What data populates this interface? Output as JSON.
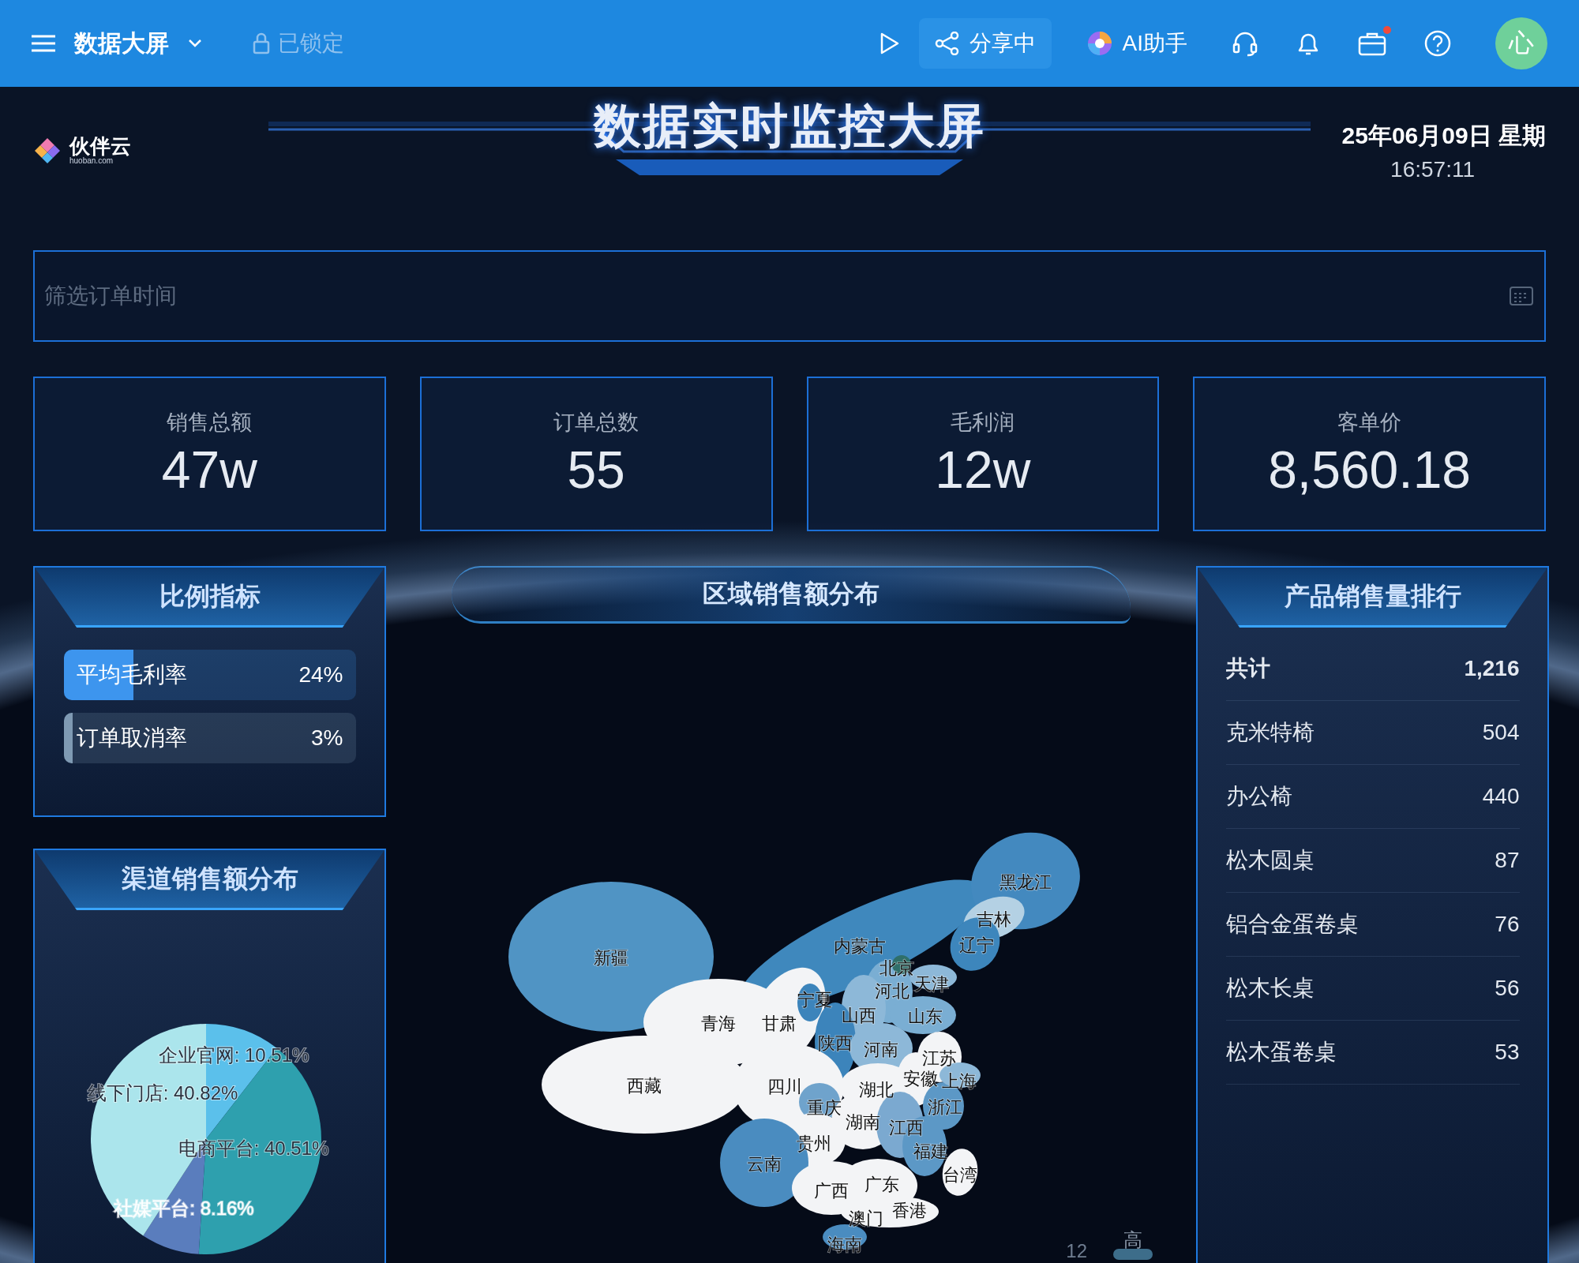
{
  "top_bar": {
    "title": "数据大屏",
    "lock_label": "已锁定",
    "locked": true,
    "share_button": "分享中",
    "ai_button": "AI助手",
    "notification_badge": true,
    "avatar_initial": "心"
  },
  "brand": {
    "name": "伙伴云",
    "domain": "huoban.com"
  },
  "header": {
    "title": "数据实时监控大屏",
    "date": "25年06月09日 星期",
    "time": "16:57:11"
  },
  "filter": {
    "placeholder": "筛选订单时间"
  },
  "kpis": [
    {
      "label": "销售总额",
      "value": "47w"
    },
    {
      "label": "订单总数",
      "value": "55"
    },
    {
      "label": "毛利润",
      "value": "12w"
    },
    {
      "label": "客单价",
      "value": "8,560.18"
    }
  ],
  "ratio_panel": {
    "title": "比例指标",
    "bars": [
      {
        "label": "平均毛利率",
        "level": 0.24,
        "reading": "24%",
        "color": "#3d95ee"
      },
      {
        "label": "订单取消率",
        "level": 0.03,
        "reading": "3%",
        "color": "#7f9ab3"
      }
    ]
  },
  "channel_panel": {
    "title": "渠道销售额分布",
    "chart_data": {
      "type": "pie",
      "values": [
        10.51,
        40.51,
        8.16,
        40.82
      ],
      "colors": [
        "#5bc0eb",
        "#2ea0ae",
        "#5a7dbd",
        "#abe5ec"
      ],
      "value_labels": [
        "企业官网: 10.51%",
        "电商平台: 40.51%",
        "社媒平台: 8.16%",
        "线下门店: 40.82%"
      ]
    }
  },
  "region_panel": {
    "title": "区域销售额分布",
    "provinces": [
      "黑龙江",
      "吉林",
      "内蒙古",
      "辽宁",
      "北京",
      "天津",
      "新疆",
      "河北",
      "宁夏",
      "山西",
      "山东",
      "青海",
      "甘肃",
      "陕西",
      "河南",
      "江苏",
      "西藏",
      "四川",
      "湖北",
      "安徽",
      "上海",
      "重庆",
      "浙江",
      "湖南",
      "江西",
      "贵州",
      "福建",
      "云南",
      "台湾",
      "广西",
      "广东",
      "香港",
      "澳门",
      "海南"
    ],
    "legend": {
      "high_label": "高",
      "value": "12"
    }
  },
  "product_panel": {
    "title": "产品销售量排行",
    "total": {
      "label": "共计",
      "value": "1,216"
    },
    "rows": [
      {
        "name": "克米特椅",
        "value": "504"
      },
      {
        "name": "办公椅",
        "value": "440"
      },
      {
        "name": "松木圆桌",
        "value": "87"
      },
      {
        "name": "铝合金蛋卷桌",
        "value": "76"
      },
      {
        "name": "松木长桌",
        "value": "56"
      },
      {
        "name": "松木蛋卷桌",
        "value": "53"
      }
    ]
  }
}
